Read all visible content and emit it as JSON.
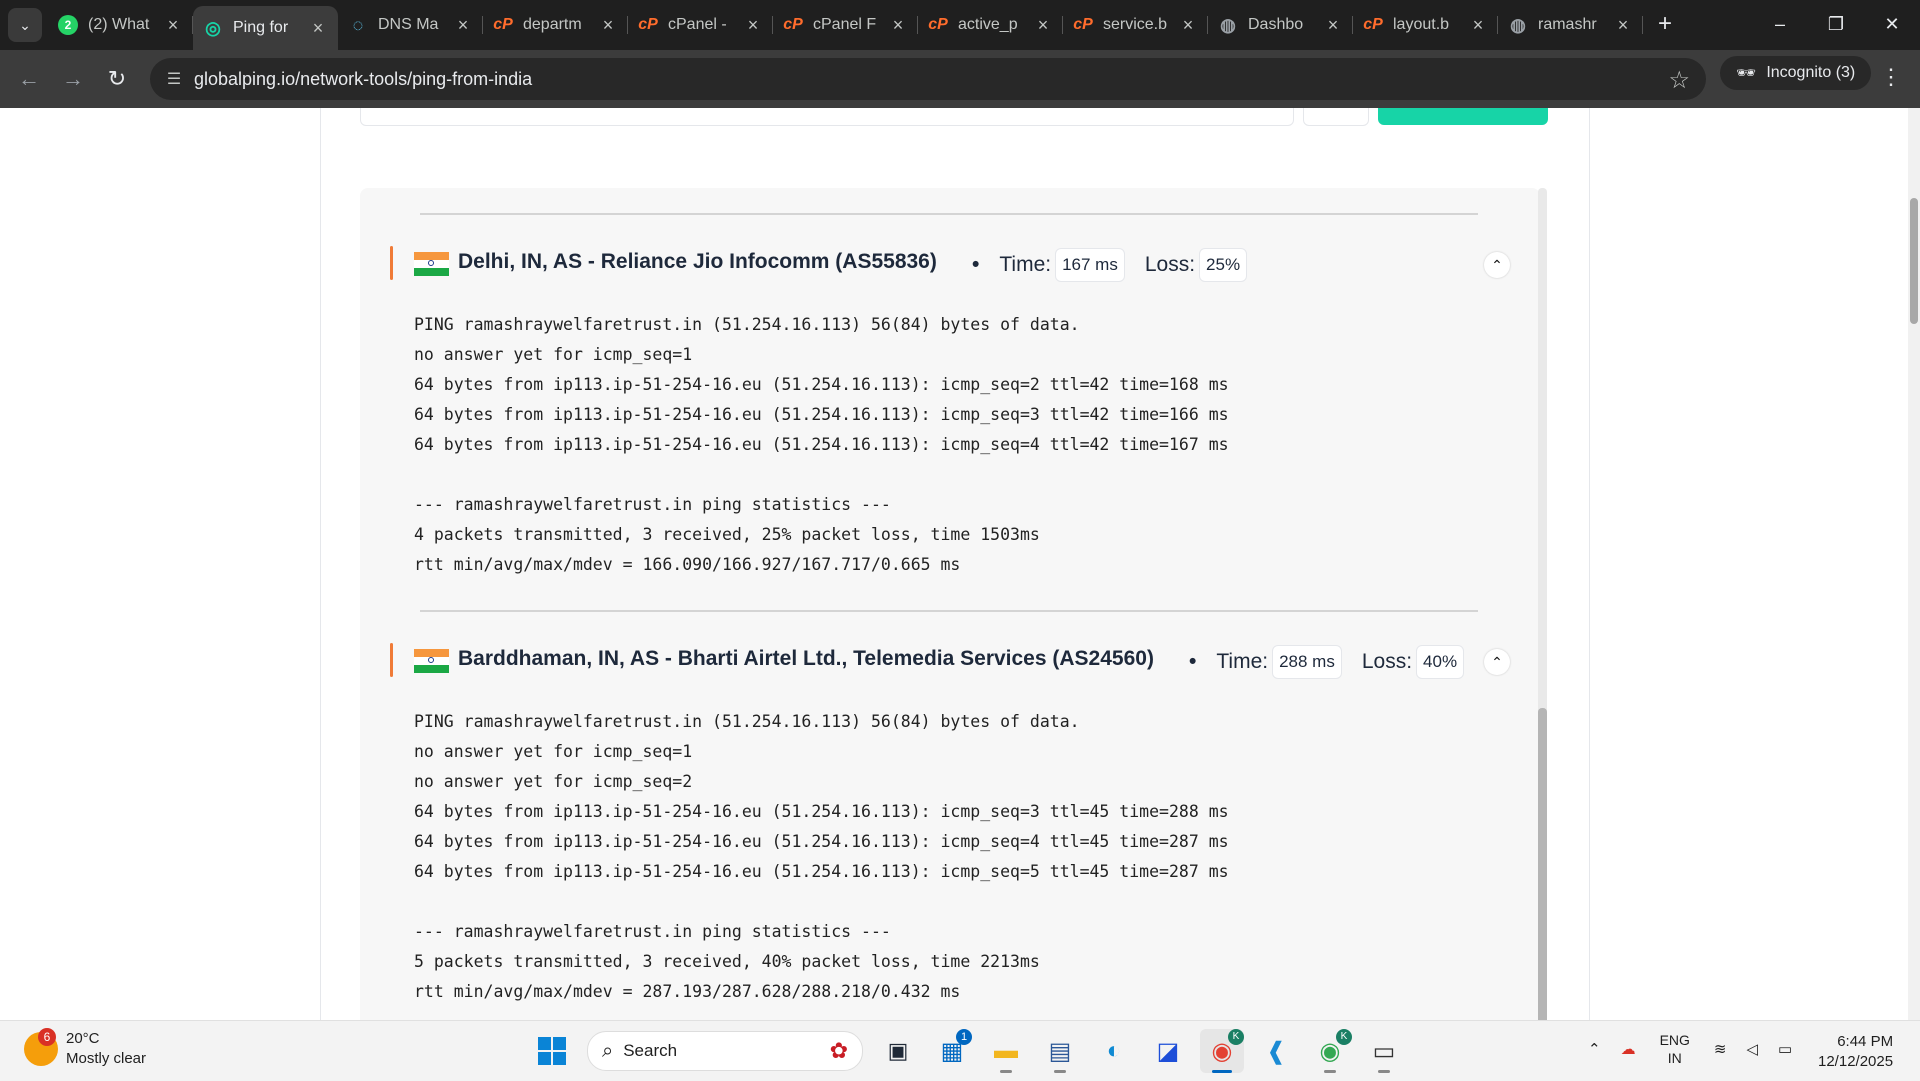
{
  "browser": {
    "tabs": [
      {
        "label": "(2) What",
        "favicon": "whatsapp-icon",
        "badge": "2",
        "active": false
      },
      {
        "label": "Ping for",
        "favicon": "globalping-icon",
        "active": true
      },
      {
        "label": "DNS Ma",
        "favicon": "dns-icon",
        "active": false
      },
      {
        "label": "departm",
        "favicon": "cpanel-icon",
        "active": false
      },
      {
        "label": "cPanel -",
        "favicon": "cpanel-icon",
        "active": false
      },
      {
        "label": "cPanel F",
        "favicon": "cpanel-icon",
        "active": false
      },
      {
        "label": "active_p",
        "favicon": "cpanel-icon",
        "active": false
      },
      {
        "label": "service.b",
        "favicon": "cpanel-icon",
        "active": false
      },
      {
        "label": "Dashbo",
        "favicon": "globe-icon",
        "active": false
      },
      {
        "label": "layout.b",
        "favicon": "cpanel-icon",
        "active": false
      },
      {
        "label": "ramashr",
        "favicon": "globe-icon",
        "active": false
      }
    ],
    "url": "globalping.io/network-tools/ping-from-india",
    "incognito_label": "Incognito (3)"
  },
  "results": [
    {
      "title": "Delhi, IN, AS - Reliance Jio Infocomm (AS55836)",
      "time_label": "Time:",
      "time_value": "167 ms",
      "loss_label": "Loss:",
      "loss_value": "25%",
      "lines": [
        "PING ramashraywelfaretrust.in (51.254.16.113) 56(84) bytes of data.",
        "no answer yet for icmp_seq=1",
        "64 bytes from ip113.ip-51-254-16.eu (51.254.16.113): icmp_seq=2 ttl=42 time=168 ms",
        "64 bytes from ip113.ip-51-254-16.eu (51.254.16.113): icmp_seq=3 ttl=42 time=166 ms",
        "64 bytes from ip113.ip-51-254-16.eu (51.254.16.113): icmp_seq=4 ttl=42 time=167 ms",
        "",
        "--- ramashraywelfaretrust.in ping statistics ---",
        "4 packets transmitted, 3 received, 25% packet loss, time 1503ms",
        "rtt min/avg/max/mdev = 166.090/166.927/167.717/0.665 ms"
      ]
    },
    {
      "title": "Barddhaman, IN, AS - Bharti Airtel Ltd., Telemedia Services (AS24560)",
      "time_label": "Time:",
      "time_value": "288 ms",
      "loss_label": "Loss:",
      "loss_value": "40%",
      "lines": [
        "PING ramashraywelfaretrust.in (51.254.16.113) 56(84) bytes of data.",
        "no answer yet for icmp_seq=1",
        "no answer yet for icmp_seq=2",
        "64 bytes from ip113.ip-51-254-16.eu (51.254.16.113): icmp_seq=3 ttl=45 time=288 ms",
        "64 bytes from ip113.ip-51-254-16.eu (51.254.16.113): icmp_seq=4 ttl=45 time=287 ms",
        "64 bytes from ip113.ip-51-254-16.eu (51.254.16.113): icmp_seq=5 ttl=45 time=287 ms",
        "",
        "--- ramashraywelfaretrust.in ping statistics ---",
        "5 packets transmitted, 3 received, 40% packet loss, time 2213ms",
        "rtt min/avg/max/mdev = 287.193/287.628/288.218/0.432 ms"
      ]
    }
  ],
  "taskbar": {
    "weather_badge": "6",
    "temperature": "20°C",
    "condition": "Mostly clear",
    "search_placeholder": "Search",
    "store_badge": "1",
    "profile_badge": "K",
    "lang_top": "ENG",
    "lang_bottom": "IN",
    "time": "6:44 PM",
    "date": "12/12/2025"
  },
  "colors": {
    "accent_green": "#17d4a7",
    "probe_accent": "#f07b37",
    "chrome_dark": "#1f1f1f"
  }
}
